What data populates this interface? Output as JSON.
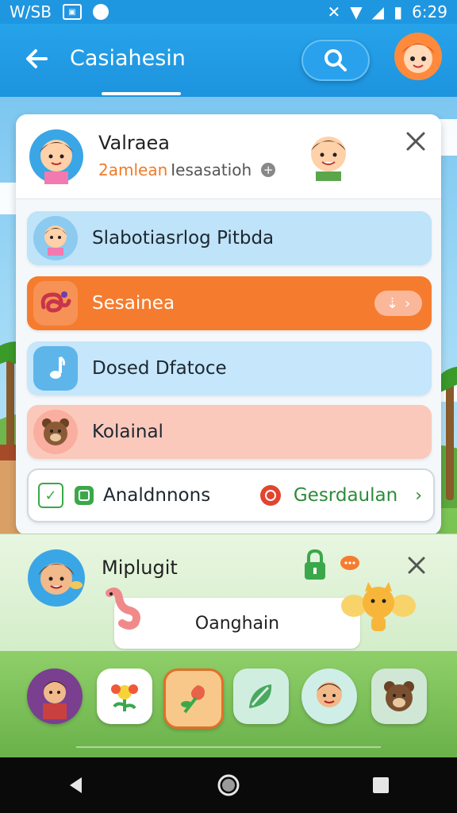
{
  "status_bar": {
    "carrier": "W/SB",
    "time": "6:29"
  },
  "app_bar": {
    "title": "Casiahesin"
  },
  "card": {
    "header": {
      "name": "Valraea",
      "subtitle_accent": "2amlean",
      "subtitle_rest": " Iesasatioh"
    },
    "rows": [
      {
        "label": "Slabotiasrlog Pitbda"
      },
      {
        "label": "Sesainea"
      },
      {
        "label": "Dosed Dfatoce"
      },
      {
        "label": "Kolainal"
      },
      {
        "label": "Analdnnons",
        "right_label": "Gesrdaulan"
      }
    ]
  },
  "panel": {
    "title": "Miplugit",
    "input_text": "Oanghain"
  },
  "colors": {
    "primary": "#1f96e0",
    "orange": "#f57c2e",
    "green": "#2e8b3a"
  }
}
